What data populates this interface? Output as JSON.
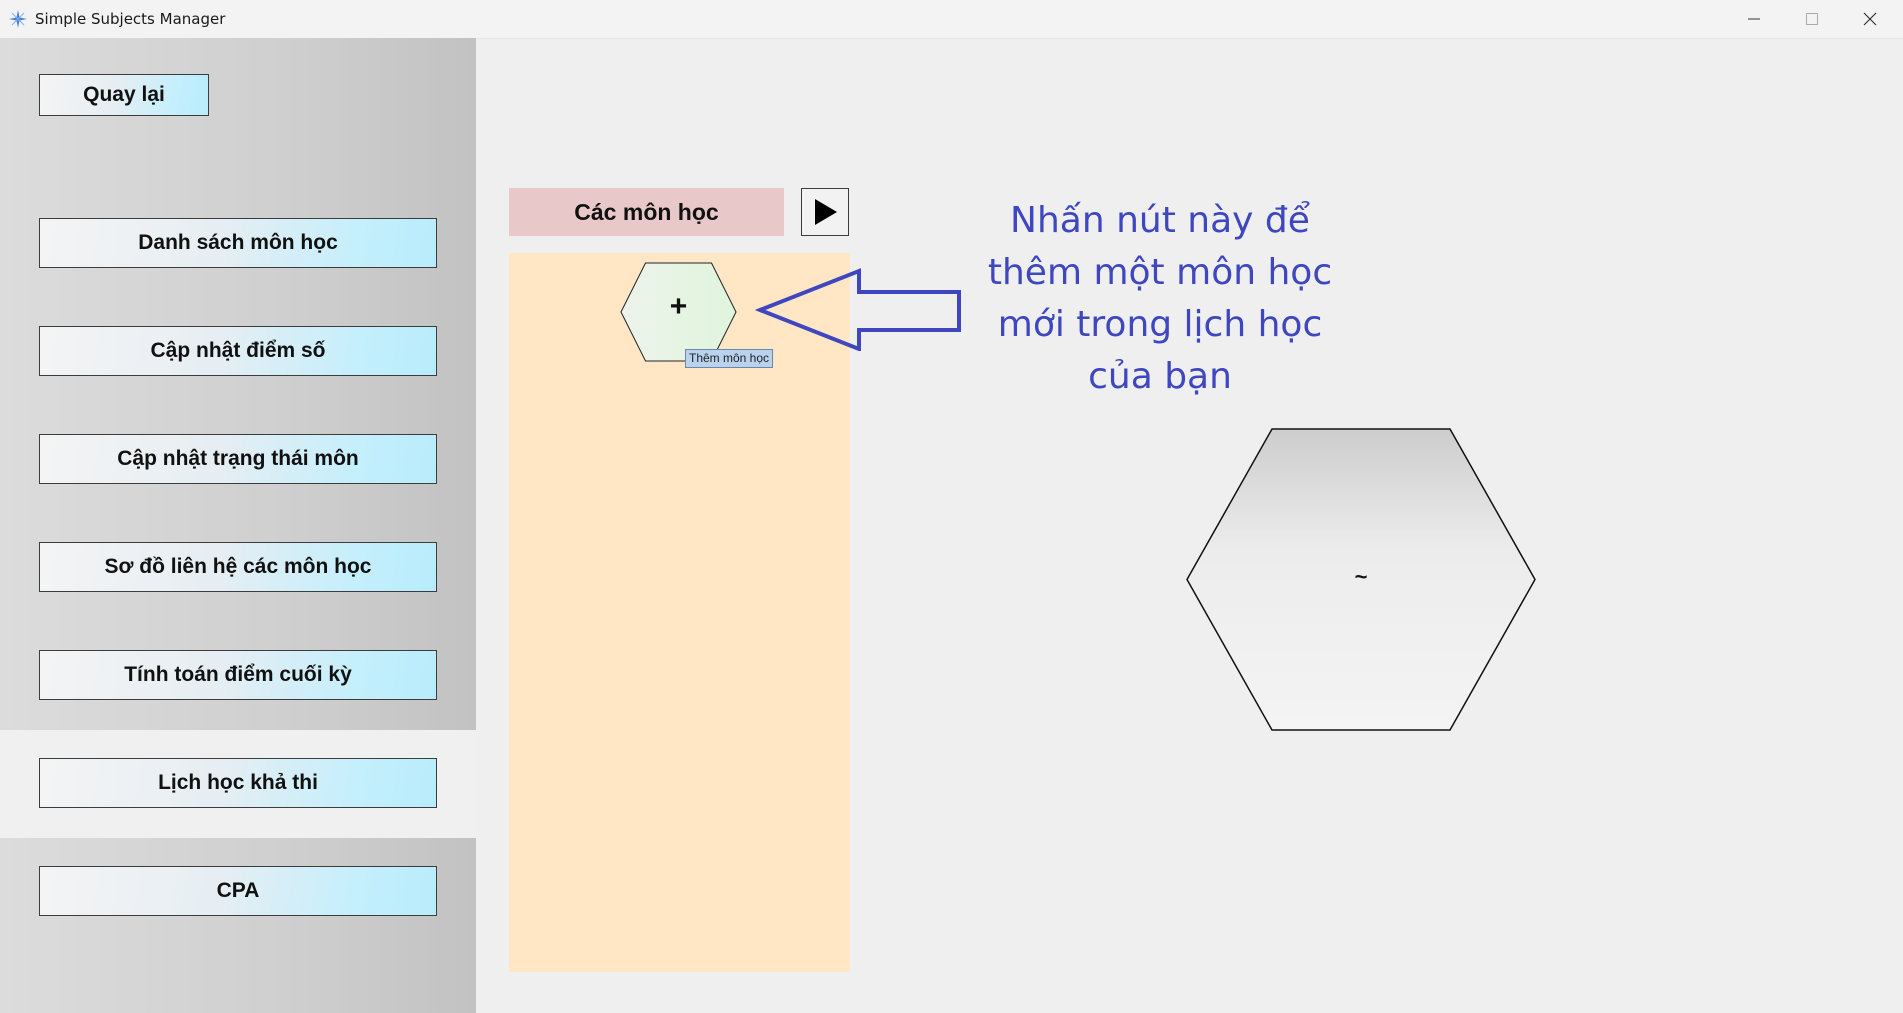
{
  "window": {
    "title": "Simple Subjects Manager",
    "app_icon": "sparkle-icon",
    "controls": [
      "minimize-icon",
      "maximize-icon",
      "close-icon"
    ]
  },
  "sidebar": {
    "back_label": "Quay lại",
    "items": [
      {
        "label": "Danh sách môn học"
      },
      {
        "label": "Cập nhật điểm số"
      },
      {
        "label": "Cập nhật trạng thái môn"
      },
      {
        "label": "Sơ đồ liên hệ các môn học"
      },
      {
        "label": "Tính toán điểm cuối kỳ"
      },
      {
        "label": "Lịch học khả thi"
      },
      {
        "label": "CPA"
      }
    ],
    "active_item": "Lịch học khả thi"
  },
  "main": {
    "subjects_header": "Các môn học",
    "play_icon": "play-icon",
    "add_button": {
      "symbol": "+",
      "tooltip": "Thêm môn học"
    },
    "hint_lines": [
      "Nhấn nút này để",
      "thêm một môn học",
      "mới trong lịch học",
      "của bạn"
    ],
    "big_hex_symbol": "~"
  },
  "colors": {
    "accent_button": "#b8ecfc",
    "header_bg": "#e9c8c9",
    "panel_bg": "#ffe6c4",
    "hint_text": "#3e46c0",
    "arrow": "#3e46c0"
  }
}
